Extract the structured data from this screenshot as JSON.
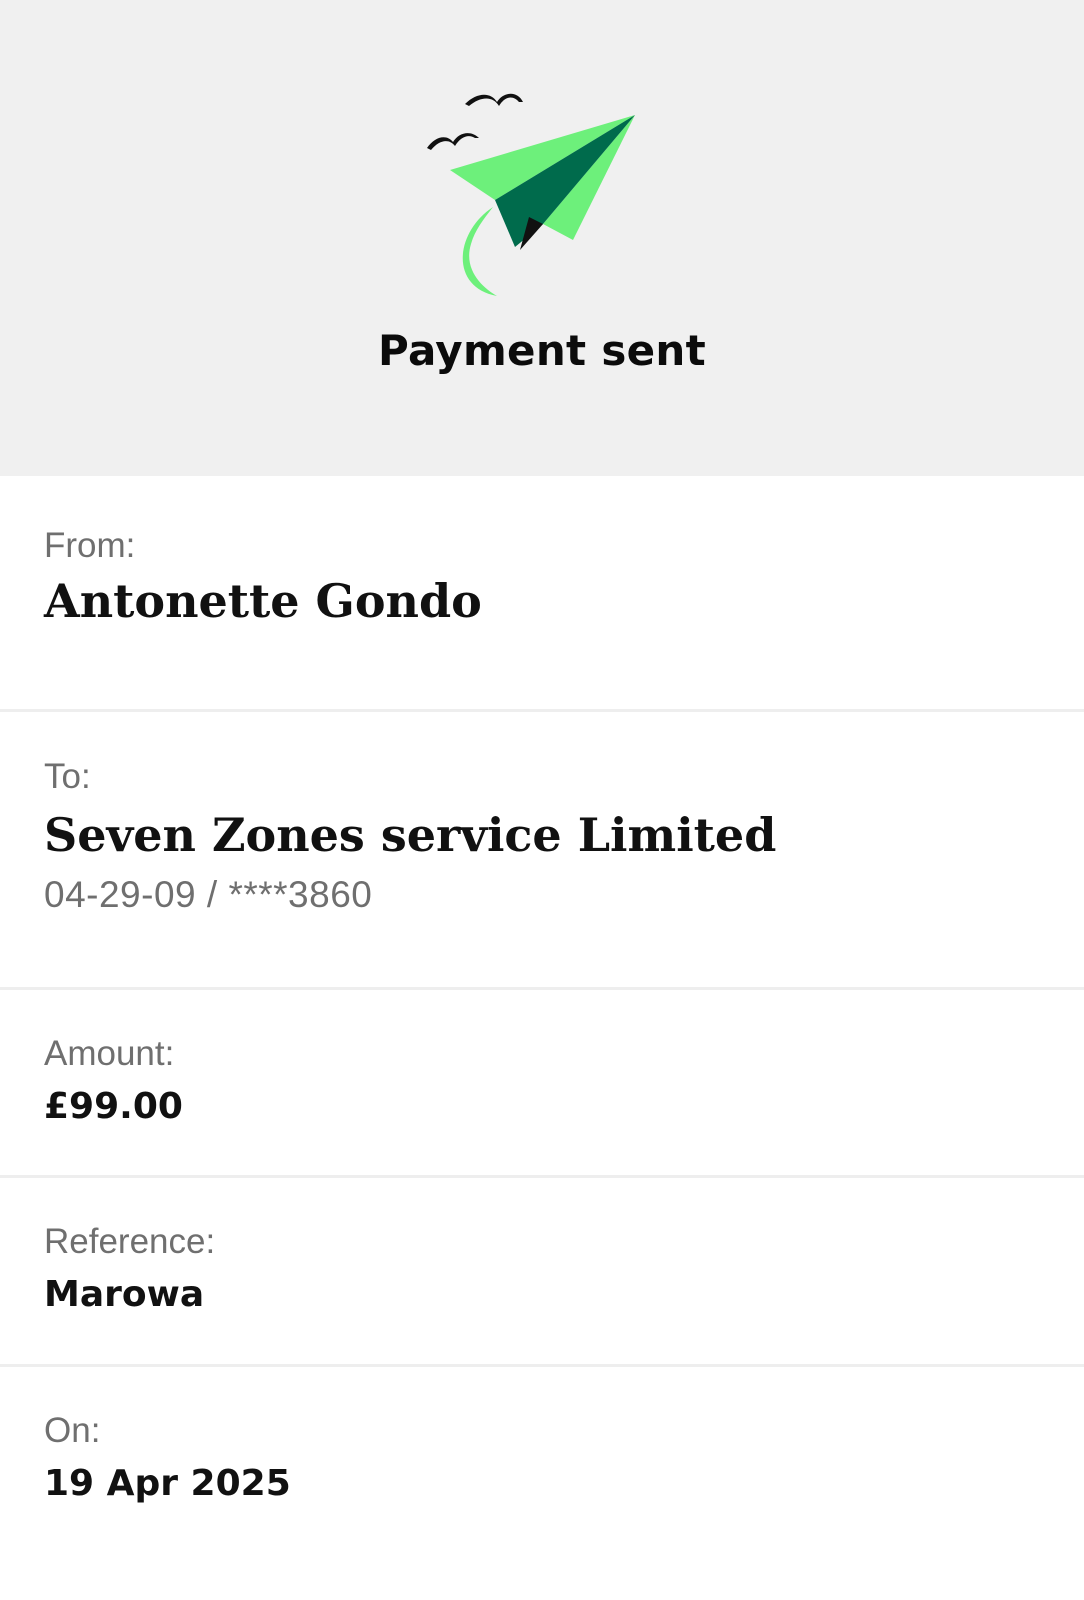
{
  "header": {
    "title": "Payment sent",
    "illustration_icon": "paper-plane-with-birds-icon",
    "colors": {
      "plane_light": "#6df07b",
      "plane_dark": "#006b4c",
      "outline": "#111111",
      "background": "#f0f0f0"
    }
  },
  "details": {
    "from": {
      "label": "From:",
      "name": "Antonette Gondo"
    },
    "to": {
      "label": "To:",
      "name": "Seven Zones service Limited",
      "account": "04-29-09 / ****3860"
    },
    "amount": {
      "label": "Amount:",
      "value": "£99.00"
    },
    "reference": {
      "label": "Reference:",
      "value": "Marowa"
    },
    "on": {
      "label": "On:",
      "value": "19 Apr 2025"
    }
  }
}
